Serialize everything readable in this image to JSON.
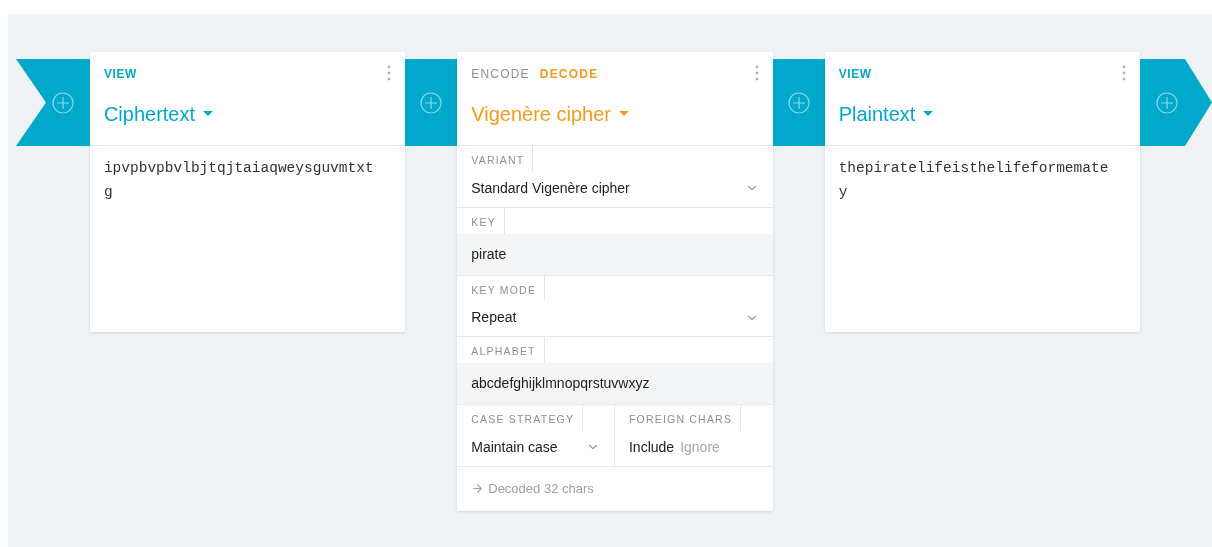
{
  "pipeline": [
    {
      "kind": "view",
      "mode": "VIEW",
      "title": "Ciphertext",
      "content": "ipvpbvpbvlbjtqjtaiaqweysguvmtxtg"
    },
    {
      "kind": "encoder",
      "modes": [
        {
          "label": "ENCODE",
          "selected": false
        },
        {
          "label": "DECODE",
          "selected": true
        }
      ],
      "title": "Vigenère cipher",
      "fields": [
        {
          "kind": "select",
          "label": "VARIANT",
          "value": "Standard Vigenère cipher"
        },
        {
          "kind": "text",
          "label": "KEY",
          "value": "pirate"
        },
        {
          "kind": "select",
          "label": "KEY MODE",
          "value": "Repeat"
        },
        {
          "kind": "text",
          "label": "ALPHABET",
          "value": "abcdefghijklmnopqrstuvwxyz"
        },
        {
          "kind": "pair",
          "items": [
            {
              "kind": "select",
              "label": "CASE STRATEGY",
              "value": "Maintain case"
            },
            {
              "kind": "toggle",
              "label": "FOREIGN CHARS",
              "options": [
                {
                  "label": "Include",
                  "selected": true
                },
                {
                  "label": "Ignore",
                  "selected": false
                }
              ]
            }
          ]
        }
      ],
      "status": "Decoded 32 chars"
    },
    {
      "kind": "view",
      "mode": "VIEW",
      "title": "Plaintext",
      "content": "thepiratelifeisthelifeformematey"
    }
  ]
}
